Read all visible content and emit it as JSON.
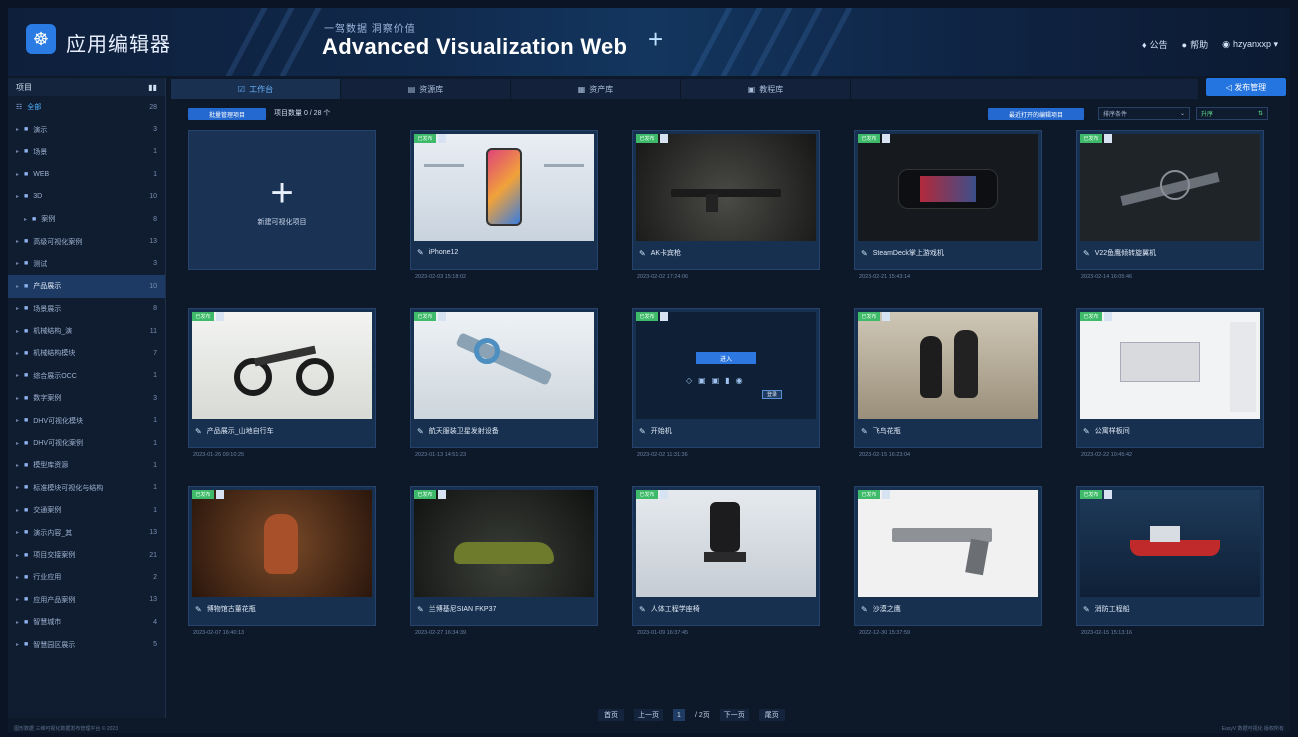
{
  "header": {
    "app_name": "应用编辑器",
    "slogan": "一驾数据 洞察价值",
    "web_title": "Advanced Visualization Web",
    "plus_deco": "+",
    "links": [
      {
        "icon": "bell-icon",
        "glyph": "♦",
        "label": "公告"
      },
      {
        "icon": "help-icon",
        "glyph": "●",
        "label": "帮助"
      },
      {
        "icon": "user-icon",
        "glyph": "◉",
        "label": "hzyanxxp ▾"
      }
    ]
  },
  "sidebar": {
    "title": "项目",
    "all": {
      "label": "全部",
      "count": "28"
    },
    "items": [
      {
        "label": "演示",
        "count": "3",
        "active": false
      },
      {
        "label": "场景",
        "count": "1",
        "active": false
      },
      {
        "label": "WEB",
        "count": "1",
        "active": false
      },
      {
        "label": "3D",
        "count": "10",
        "active": false
      },
      {
        "label": "案例",
        "count": "8",
        "active": false
      },
      {
        "label": "高级可视化案例",
        "count": "13",
        "active": false
      },
      {
        "label": "测试",
        "count": "3",
        "active": false
      },
      {
        "label": "产品展示",
        "count": "10",
        "active": true
      },
      {
        "label": "场景展示",
        "count": "8",
        "active": false
      },
      {
        "label": "机械结构_演",
        "count": "11",
        "active": false
      },
      {
        "label": "机械结构模块",
        "count": "7",
        "active": false
      },
      {
        "label": "综合展示OCC",
        "count": "1",
        "active": false
      },
      {
        "label": "数字案例",
        "count": "3",
        "active": false
      },
      {
        "label": "DHV可视化模块",
        "count": "1",
        "active": false
      },
      {
        "label": "DHV可视化案例",
        "count": "1",
        "active": false
      },
      {
        "label": "模型库资源",
        "count": "1",
        "active": false
      },
      {
        "label": "标准模块可视化与结构",
        "count": "1",
        "active": false
      },
      {
        "label": "交通案例",
        "count": "1",
        "active": false
      },
      {
        "label": "演示内容_其",
        "count": "13",
        "active": false
      },
      {
        "label": "项目交接案例",
        "count": "21",
        "active": false
      },
      {
        "label": "行业应用",
        "count": "2",
        "active": false
      },
      {
        "label": "应用产品案例",
        "count": "13",
        "active": false
      },
      {
        "label": "智慧城市",
        "count": "4",
        "active": false
      },
      {
        "label": "智慧园区展示",
        "count": "5",
        "active": false
      }
    ]
  },
  "tabs": [
    {
      "icon": "edit-icon",
      "glyph": "☑",
      "label": "工作台",
      "active": true
    },
    {
      "icon": "grid-icon",
      "glyph": "▤",
      "label": "资源库",
      "active": false
    },
    {
      "icon": "asset-icon",
      "glyph": "▦",
      "label": "资产库",
      "active": false
    },
    {
      "icon": "tutorial-icon",
      "glyph": "▣",
      "label": "教程库",
      "active": false
    }
  ],
  "publish_label": "◁ 发布管理",
  "toolbar": {
    "batch_label": "批量管理项目",
    "count_label": "项目数量 0 / 28 个",
    "recent_label": "最近打开的编辑项目",
    "sort_value": "排序条件",
    "order_value": "升序"
  },
  "new_project_label": "新建可视化项目",
  "cards": [
    {
      "name": "iPhone12",
      "date": "2023-02-03 15:18:02",
      "tag": "已发布",
      "scene": "phone"
    },
    {
      "name": "AK卡宾枪",
      "date": "2023-02-02 17:24:06",
      "tag": "已发布",
      "scene": "rifle"
    },
    {
      "name": "SteamDeck掌上游戏机",
      "date": "2023-02-21 15:43:14",
      "tag": "已发布",
      "scene": "device"
    },
    {
      "name": "V22鱼鹰倾转旋翼机",
      "date": "2023-02-14 16:05:46",
      "tag": "已发布",
      "scene": "plane"
    },
    {
      "name": "产品展示_山地自行车",
      "date": "2023-01-26 09:10:25",
      "tag": "已发布",
      "scene": "bike"
    },
    {
      "name": "航天服装卫星发射设备",
      "date": "2023-01-13 14:51:23",
      "tag": "已发布",
      "scene": "engine"
    },
    {
      "name": "开始机",
      "date": "2023-02-02 11:31:36",
      "tag": "已发布",
      "scene": "login"
    },
    {
      "name": "飞鸟花瓶",
      "date": "2023-02-15 16:23:04",
      "tag": "已发布",
      "scene": "vase"
    },
    {
      "name": "公寓样板间",
      "date": "2023-02-22 10:45:42",
      "tag": "已发布",
      "scene": "room"
    },
    {
      "name": "博物馆古董花瓶",
      "date": "2023-02-07 16:40:13",
      "tag": "已发布",
      "scene": "museum"
    },
    {
      "name": "兰博基尼SIAN FKP37",
      "date": "2023-02-27 16:34:39",
      "tag": "已发布",
      "scene": "car"
    },
    {
      "name": "人体工程学座椅",
      "date": "2023-01-09 16:37:45",
      "tag": "已发布",
      "scene": "chair"
    },
    {
      "name": "沙漠之鹰",
      "date": "2022-12-30 15:37:59",
      "tag": "已发布",
      "scene": "gun"
    },
    {
      "name": "消防工程船",
      "date": "2023-02-15 15:13:16",
      "tag": "已发布",
      "scene": "ship"
    }
  ],
  "login_scene": {
    "button": "进入",
    "popup": "登录"
  },
  "pager": {
    "first": "首页",
    "prev": "上一页",
    "current": "1",
    "total": "/ 2页",
    "next": "下一页",
    "last": "尾页"
  },
  "footer": {
    "left": "图形数据 三维可视化数据发布管理平台 © 2023",
    "right": "EasyV 数据可视化 版权所有"
  }
}
